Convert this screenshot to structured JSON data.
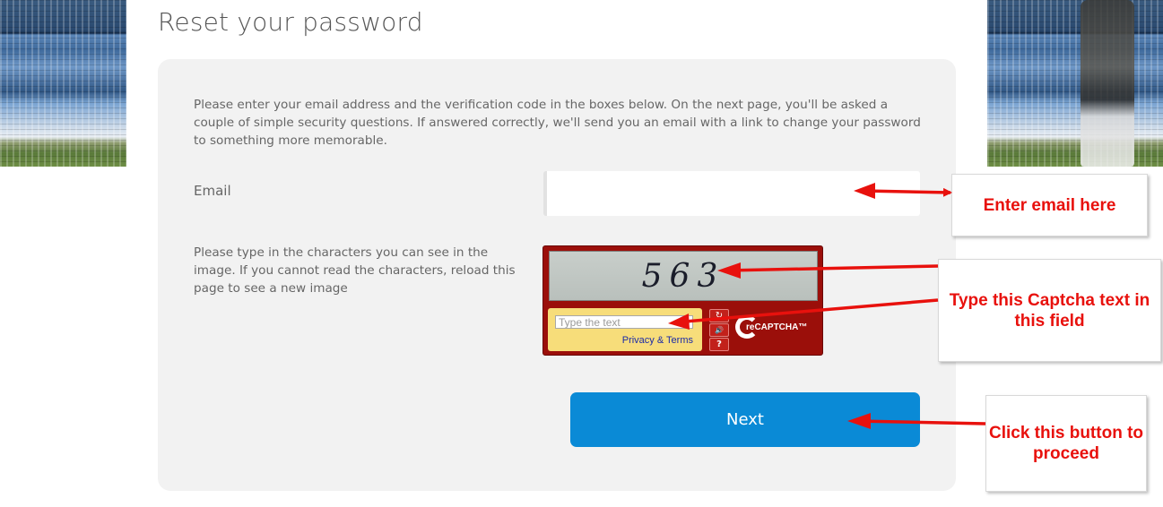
{
  "page": {
    "title": "Reset your password",
    "intro": "Please enter your email address and the verification code in the boxes below. On the next page, you'll be asked a couple of simple security questions. If answered correctly, we'll send you an email with a link to change your password to something more memorable."
  },
  "form": {
    "email_label": "Email",
    "email_value": "",
    "captcha_label": "Please type in the characters you can see in the image. If you cannot read the characters, reload this page to see a new image",
    "next_label": "Next"
  },
  "recaptcha": {
    "challenge_text": "563",
    "input_placeholder": "Type the text",
    "privacy_link": "Privacy & Terms",
    "refresh_glyph": "↻",
    "audio_glyph": "🔊",
    "help_glyph": "?",
    "logo_text": "reCAPTCHA™",
    "colors": {
      "frame": "#9b0f0a",
      "entry": "#f7dd7a"
    }
  },
  "annotations": {
    "email_note": "Enter email here",
    "captcha_note": "Type this Captcha text in this field",
    "next_note": "Click this button to proceed",
    "color": "#e8110d"
  },
  "theme": {
    "accent": "#0a8ad6",
    "card": "#f2f2f2"
  }
}
